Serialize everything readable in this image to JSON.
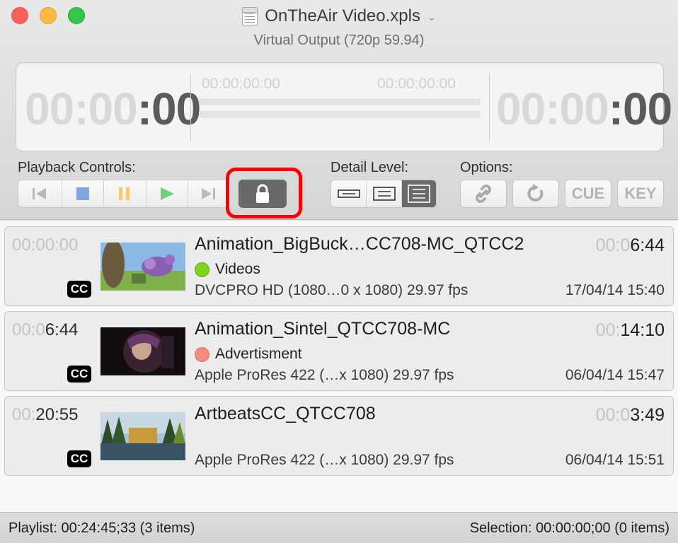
{
  "window": {
    "title": "OnTheAir Video.xpls",
    "subtitle": "Virtual Output (720p 59.94)"
  },
  "timers": {
    "elapsed": {
      "dim": "00:00",
      "bright": ":00"
    },
    "range_start": "00:00:00:00",
    "range_end": "00:00:00:00",
    "remaining": {
      "dim": "00:00",
      "bright": ":00"
    }
  },
  "sections": {
    "playback_label": "Playback Controls:",
    "detail_label": "Detail Level:",
    "options_label": "Options:"
  },
  "playback_buttons": [
    "skip-to-start",
    "stop",
    "pause",
    "play",
    "skip-to-end"
  ],
  "lock_button": {
    "icon": "lock-icon",
    "state": "locked"
  },
  "detail_levels": {
    "options": [
      "low",
      "medium",
      "high"
    ],
    "selected": "high"
  },
  "options_buttons": {
    "link_icon": "link-icon",
    "loop_icon": "refresh-icon",
    "cue_label": "CUE",
    "key_label": "KEY"
  },
  "playlist": [
    {
      "start_dim": "00:00:00",
      "start_bright": "",
      "cc": "CC",
      "name": "Animation_BigBuck…CC708-MC_QTCC2",
      "duration_dim": "00:0",
      "duration_bright": "6:44",
      "category": "Videos",
      "category_color": "#7ed321",
      "format": "DVCPRO HD (1080…0 x 1080) 29.97 fps",
      "date": "17/04/14 15:40"
    },
    {
      "start_dim": "00:0",
      "start_bright": "6:44",
      "cc": "CC",
      "name": "Animation_Sintel_QTCC708-MC",
      "duration_dim": "00:",
      "duration_bright": "14:10",
      "category": "Advertisment",
      "category_color": "#f58a80",
      "format": "Apple ProRes 422 (…x 1080) 29.97 fps",
      "date": "06/04/14 15:47"
    },
    {
      "start_dim": "00:",
      "start_bright": "20:55",
      "cc": "CC",
      "name": "ArtbeatsCC_QTCC708",
      "duration_dim": "00:0",
      "duration_bright": "3:49",
      "category": "",
      "category_color": "",
      "format": "Apple ProRes 422 (…x 1080) 29.97 fps",
      "date": "06/04/14 15:51"
    }
  ],
  "status": {
    "playlist": "Playlist: 00:24:45;33 (3 items)",
    "selection": "Selection: 00:00:00;00 (0 items)"
  }
}
